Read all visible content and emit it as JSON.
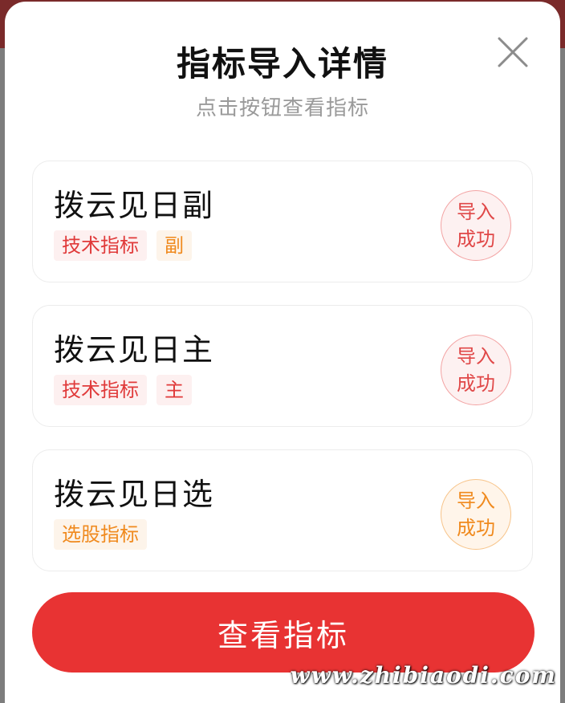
{
  "dialog": {
    "title": "指标导入详情",
    "subtitle": "点击按钮查看指标",
    "close_icon": "close-icon"
  },
  "items": [
    {
      "name": "拨云见日副",
      "tags": [
        {
          "label": "技术指标",
          "color": "#e03a3a"
        },
        {
          "label": "副",
          "color": "#f08a1e"
        }
      ],
      "status": [
        "导入",
        "成功"
      ],
      "status_color": "#e04848"
    },
    {
      "name": "拨云见日主",
      "tags": [
        {
          "label": "技术指标",
          "color": "#e03a3a"
        },
        {
          "label": "主",
          "color": "#e03a3a"
        }
      ],
      "status": [
        "导入",
        "成功"
      ],
      "status_color": "#e04848"
    },
    {
      "name": "拨云见日选",
      "tags": [
        {
          "label": "选股指标",
          "color": "#f08a1e"
        }
      ],
      "status": [
        "导入",
        "成功"
      ],
      "status_color": "#f08a1e"
    }
  ],
  "primary_button": {
    "label": "查看指标",
    "color": "#e83333"
  },
  "watermark": "www.zhibiaodi.com"
}
